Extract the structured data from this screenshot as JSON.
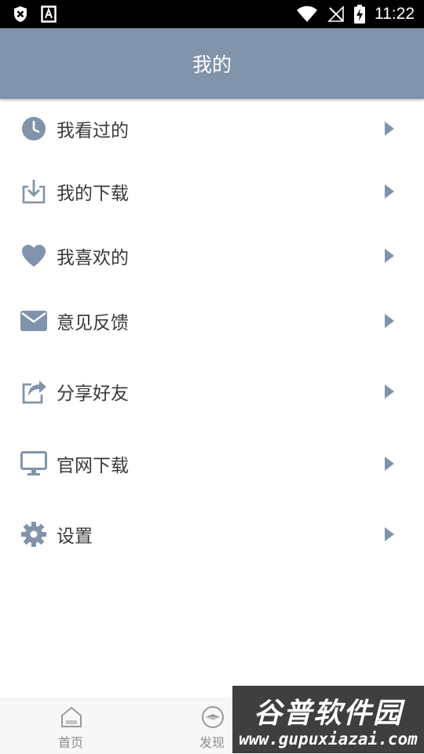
{
  "status_bar": {
    "time": "11:22"
  },
  "header": {
    "title": "我的"
  },
  "menu": {
    "items": [
      {
        "label": "我看过的",
        "icon": "clock-icon"
      },
      {
        "label": "我的下载",
        "icon": "download-icon"
      },
      {
        "label": "我喜欢的",
        "icon": "heart-icon"
      },
      {
        "label": "意见反馈",
        "icon": "mail-icon"
      },
      {
        "label": "分享好友",
        "icon": "share-icon"
      },
      {
        "label": "官网下载",
        "icon": "monitor-icon"
      },
      {
        "label": "设置",
        "icon": "gear-icon"
      }
    ]
  },
  "bottom_nav": {
    "tabs": [
      {
        "label": "首页",
        "icon": "home-icon"
      },
      {
        "label": "发现",
        "icon": "discover-icon"
      }
    ]
  },
  "watermark": {
    "title": "谷普软件园",
    "url": "www.gupuxiazai.com"
  },
  "colors": {
    "accent": "#8093ab",
    "icon": "#8093ab",
    "text": "#3a3a3a",
    "tab_text": "#8c8c8c"
  }
}
